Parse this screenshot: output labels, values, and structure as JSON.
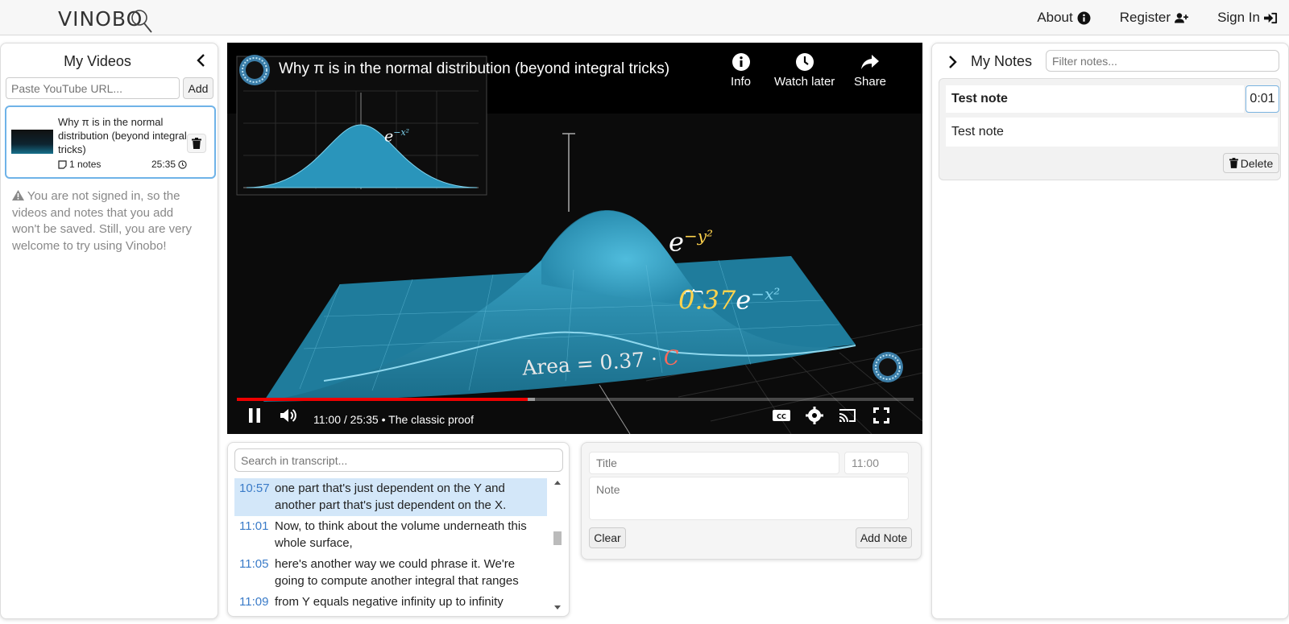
{
  "header": {
    "logo": "VINOBO",
    "nav": [
      {
        "label": "About",
        "icon": "info-icon"
      },
      {
        "label": "Register",
        "icon": "user-plus-icon"
      },
      {
        "label": "Sign In",
        "icon": "sign-in-icon"
      }
    ]
  },
  "my_videos": {
    "title": "My Videos",
    "url_placeholder": "Paste YouTube URL...",
    "add_label": "Add",
    "videos": [
      {
        "title": "Why π is in the normal distribution (beyond integral tricks)",
        "notes": "1 notes",
        "duration": "25:35"
      }
    ],
    "warning": "You are not signed in, so the videos and notes that you add won't be saved. Still, you are very welcome to try using Vinobo!"
  },
  "player": {
    "title": "Why π is in the normal distribution (beyond integral tricks)",
    "info_label": "Info",
    "watch_later_label": "Watch later",
    "share_label": "Share",
    "time": "11:00 / 25:35",
    "chapter": "The classic proof",
    "played_fraction": 0.43,
    "loaded_fraction": 0.44,
    "overlay_formula_top": "e",
    "overlay_formula_top_exp": "−y²",
    "overlay_factor": "0.37",
    "overlay_formula_right_exp": "−x²",
    "overlay_area": "Area = 0.37 · ",
    "overlay_area_c": "C",
    "inset_formula": "e",
    "inset_formula_exp": "−x²"
  },
  "transcript": {
    "search_placeholder": "Search in transcript...",
    "rows": [
      {
        "time": "10:57",
        "text": "one part that's just dependent on the Y and another part that's just dependent on the X.",
        "active": true
      },
      {
        "time": "11:01",
        "text": "Now, to think about the volume  underneath this whole surface,",
        "active": false
      },
      {
        "time": "11:05",
        "text": "here's another way we could phrase it. We're going to compute another integral that ranges",
        "active": false
      },
      {
        "time": "11:09",
        "text": "from Y equals negative infinity up to infinity",
        "active": false
      }
    ]
  },
  "note_form": {
    "title_placeholder": "Title",
    "time_value": "11:00",
    "note_placeholder": "Note",
    "clear_label": "Clear",
    "add_note_label": "Add Note"
  },
  "my_notes": {
    "title": "My Notes",
    "filter_placeholder": "Filter notes...",
    "notes": [
      {
        "title": "Test note",
        "time": "0:01",
        "body": "Test note",
        "delete_label": "Delete"
      }
    ]
  },
  "colors": {
    "accent": "#3a7bc8",
    "progress_red": "#e00000",
    "surface_blue": "#2a8fb3",
    "highlight_row": "#d3e7f9"
  }
}
